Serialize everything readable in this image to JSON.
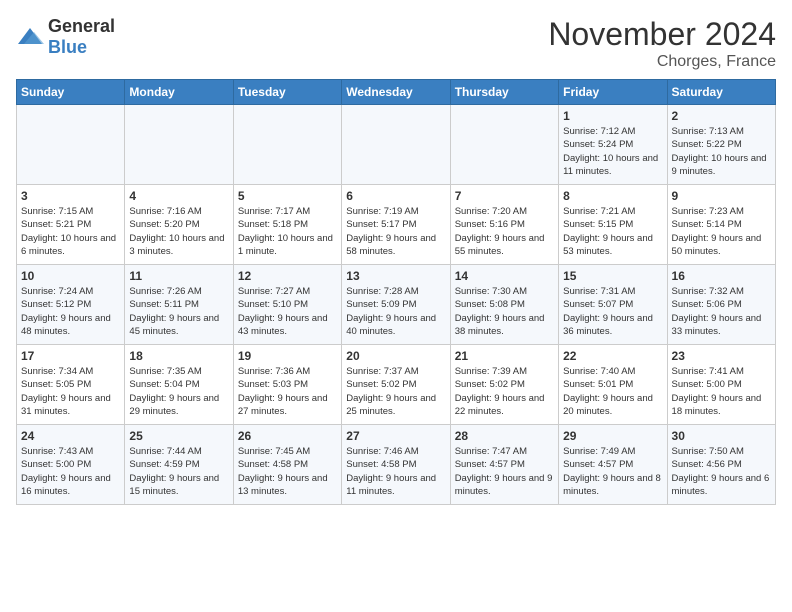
{
  "logo": {
    "general": "General",
    "blue": "Blue"
  },
  "header": {
    "month": "November 2024",
    "location": "Chorges, France"
  },
  "weekdays": [
    "Sunday",
    "Monday",
    "Tuesday",
    "Wednesday",
    "Thursday",
    "Friday",
    "Saturday"
  ],
  "weeks": [
    [
      {
        "day": "",
        "info": ""
      },
      {
        "day": "",
        "info": ""
      },
      {
        "day": "",
        "info": ""
      },
      {
        "day": "",
        "info": ""
      },
      {
        "day": "",
        "info": ""
      },
      {
        "day": "1",
        "info": "Sunrise: 7:12 AM\nSunset: 5:24 PM\nDaylight: 10 hours and 11 minutes."
      },
      {
        "day": "2",
        "info": "Sunrise: 7:13 AM\nSunset: 5:22 PM\nDaylight: 10 hours and 9 minutes."
      }
    ],
    [
      {
        "day": "3",
        "info": "Sunrise: 7:15 AM\nSunset: 5:21 PM\nDaylight: 10 hours and 6 minutes."
      },
      {
        "day": "4",
        "info": "Sunrise: 7:16 AM\nSunset: 5:20 PM\nDaylight: 10 hours and 3 minutes."
      },
      {
        "day": "5",
        "info": "Sunrise: 7:17 AM\nSunset: 5:18 PM\nDaylight: 10 hours and 1 minute."
      },
      {
        "day": "6",
        "info": "Sunrise: 7:19 AM\nSunset: 5:17 PM\nDaylight: 9 hours and 58 minutes."
      },
      {
        "day": "7",
        "info": "Sunrise: 7:20 AM\nSunset: 5:16 PM\nDaylight: 9 hours and 55 minutes."
      },
      {
        "day": "8",
        "info": "Sunrise: 7:21 AM\nSunset: 5:15 PM\nDaylight: 9 hours and 53 minutes."
      },
      {
        "day": "9",
        "info": "Sunrise: 7:23 AM\nSunset: 5:14 PM\nDaylight: 9 hours and 50 minutes."
      }
    ],
    [
      {
        "day": "10",
        "info": "Sunrise: 7:24 AM\nSunset: 5:12 PM\nDaylight: 9 hours and 48 minutes."
      },
      {
        "day": "11",
        "info": "Sunrise: 7:26 AM\nSunset: 5:11 PM\nDaylight: 9 hours and 45 minutes."
      },
      {
        "day": "12",
        "info": "Sunrise: 7:27 AM\nSunset: 5:10 PM\nDaylight: 9 hours and 43 minutes."
      },
      {
        "day": "13",
        "info": "Sunrise: 7:28 AM\nSunset: 5:09 PM\nDaylight: 9 hours and 40 minutes."
      },
      {
        "day": "14",
        "info": "Sunrise: 7:30 AM\nSunset: 5:08 PM\nDaylight: 9 hours and 38 minutes."
      },
      {
        "day": "15",
        "info": "Sunrise: 7:31 AM\nSunset: 5:07 PM\nDaylight: 9 hours and 36 minutes."
      },
      {
        "day": "16",
        "info": "Sunrise: 7:32 AM\nSunset: 5:06 PM\nDaylight: 9 hours and 33 minutes."
      }
    ],
    [
      {
        "day": "17",
        "info": "Sunrise: 7:34 AM\nSunset: 5:05 PM\nDaylight: 9 hours and 31 minutes."
      },
      {
        "day": "18",
        "info": "Sunrise: 7:35 AM\nSunset: 5:04 PM\nDaylight: 9 hours and 29 minutes."
      },
      {
        "day": "19",
        "info": "Sunrise: 7:36 AM\nSunset: 5:03 PM\nDaylight: 9 hours and 27 minutes."
      },
      {
        "day": "20",
        "info": "Sunrise: 7:37 AM\nSunset: 5:02 PM\nDaylight: 9 hours and 25 minutes."
      },
      {
        "day": "21",
        "info": "Sunrise: 7:39 AM\nSunset: 5:02 PM\nDaylight: 9 hours and 22 minutes."
      },
      {
        "day": "22",
        "info": "Sunrise: 7:40 AM\nSunset: 5:01 PM\nDaylight: 9 hours and 20 minutes."
      },
      {
        "day": "23",
        "info": "Sunrise: 7:41 AM\nSunset: 5:00 PM\nDaylight: 9 hours and 18 minutes."
      }
    ],
    [
      {
        "day": "24",
        "info": "Sunrise: 7:43 AM\nSunset: 5:00 PM\nDaylight: 9 hours and 16 minutes."
      },
      {
        "day": "25",
        "info": "Sunrise: 7:44 AM\nSunset: 4:59 PM\nDaylight: 9 hours and 15 minutes."
      },
      {
        "day": "26",
        "info": "Sunrise: 7:45 AM\nSunset: 4:58 PM\nDaylight: 9 hours and 13 minutes."
      },
      {
        "day": "27",
        "info": "Sunrise: 7:46 AM\nSunset: 4:58 PM\nDaylight: 9 hours and 11 minutes."
      },
      {
        "day": "28",
        "info": "Sunrise: 7:47 AM\nSunset: 4:57 PM\nDaylight: 9 hours and 9 minutes."
      },
      {
        "day": "29",
        "info": "Sunrise: 7:49 AM\nSunset: 4:57 PM\nDaylight: 9 hours and 8 minutes."
      },
      {
        "day": "30",
        "info": "Sunrise: 7:50 AM\nSunset: 4:56 PM\nDaylight: 9 hours and 6 minutes."
      }
    ]
  ]
}
